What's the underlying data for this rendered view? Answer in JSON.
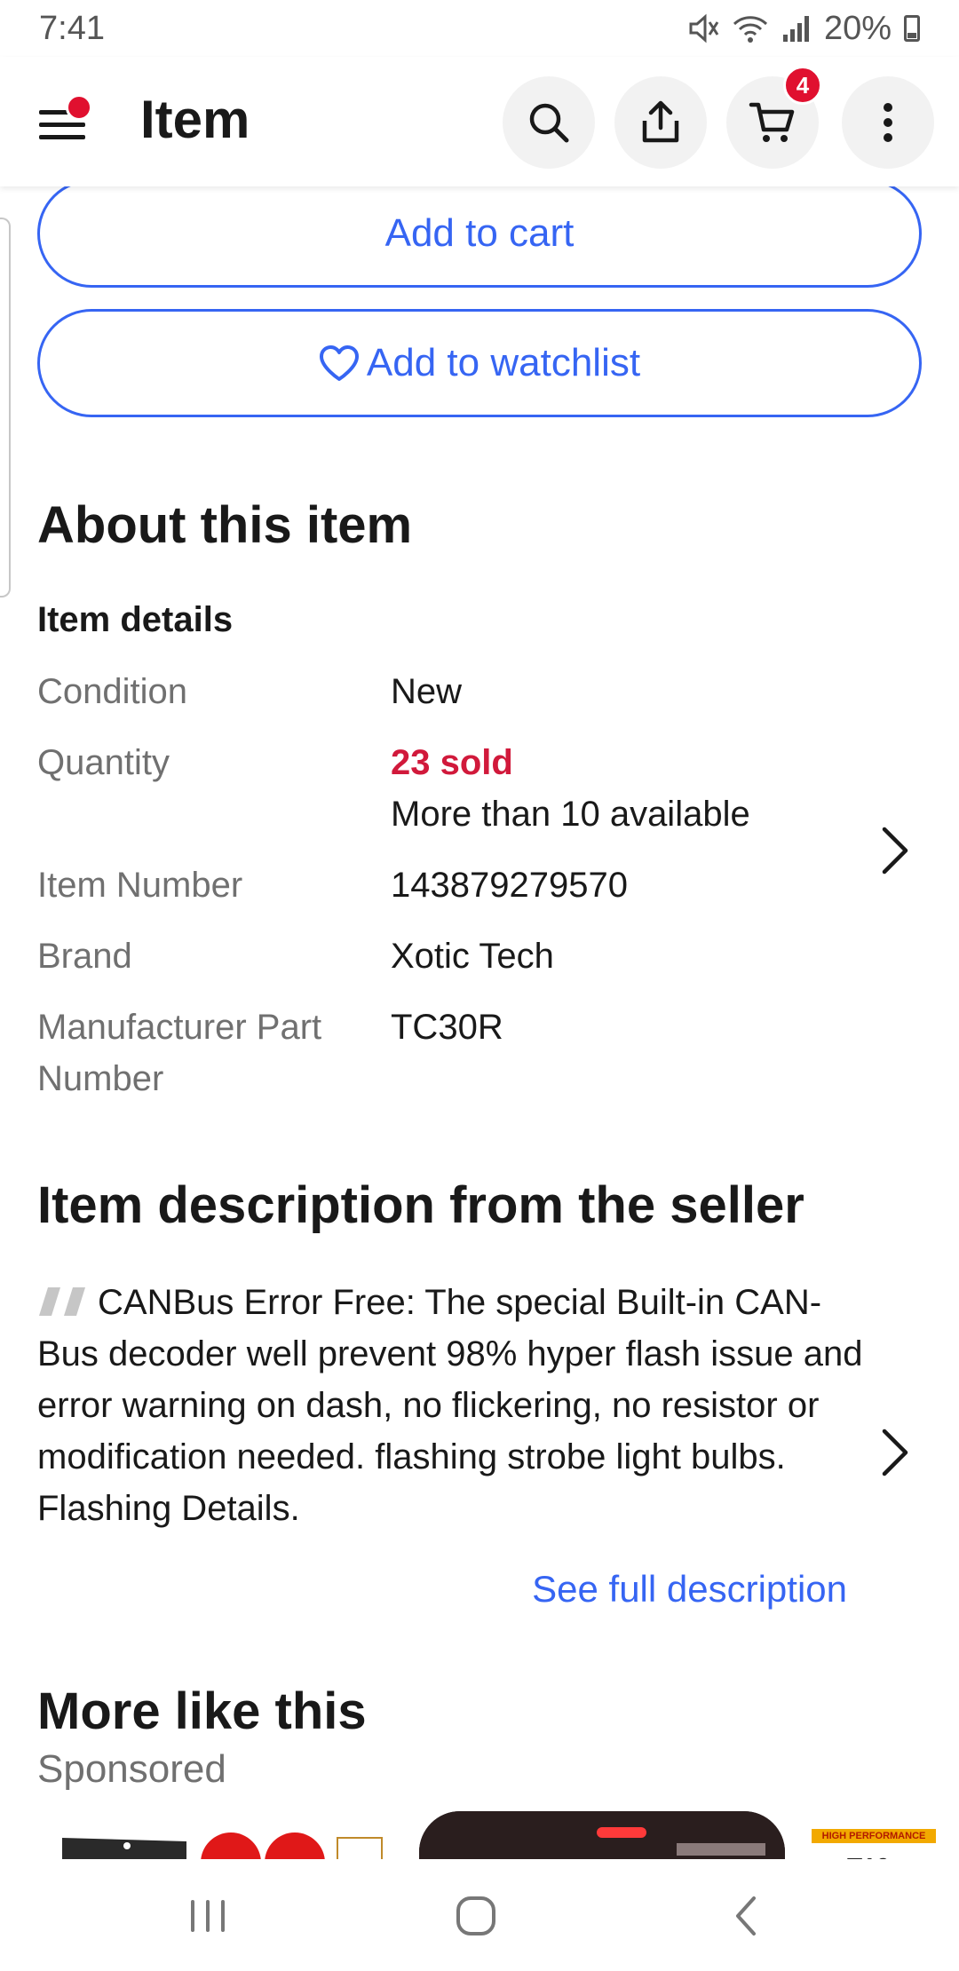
{
  "status_bar": {
    "time": "7:41",
    "battery": "20%"
  },
  "app_bar": {
    "title": "Item",
    "cart_count": "4"
  },
  "actions": {
    "add_to_cart": "Add to cart",
    "add_to_watchlist": "Add to watchlist"
  },
  "about": {
    "heading": "About this item",
    "details_heading": "Item details",
    "specs": [
      {
        "label": "Condition",
        "value": "New"
      },
      {
        "label": "Quantity",
        "value": "23 sold",
        "value2": "More than 10 available"
      },
      {
        "label": "Item Number",
        "value": "143879279570"
      },
      {
        "label": "Brand",
        "value": "Xotic Tech"
      },
      {
        "label": "Manufacturer Part",
        "label2": "Number",
        "value": "TC30R"
      }
    ]
  },
  "description": {
    "heading": "Item description from the seller",
    "text": "CANBus Error Free: The special Built-in CAN-Bus decoder well prevent 98% hyper flash issue and error warning on dash, no flickering, no resistor or modification needed. flashing strobe light bulbs. Flashing Details.",
    "see_full": "See full description"
  },
  "more_like_this": {
    "heading": "More like this",
    "subheading": "Sponsored",
    "thumb3_banner": "HIGH PERFORMANCE"
  },
  "colors": {
    "accent": "#3665f3",
    "sold": "#d1193b",
    "badge": "#e0102f"
  },
  "icons": [
    "menu-icon",
    "search-icon",
    "share-icon",
    "cart-icon",
    "more-vert-icon",
    "heart-icon",
    "chevron-right-icon",
    "quote-icon",
    "recents-icon",
    "home-icon",
    "back-icon"
  ]
}
